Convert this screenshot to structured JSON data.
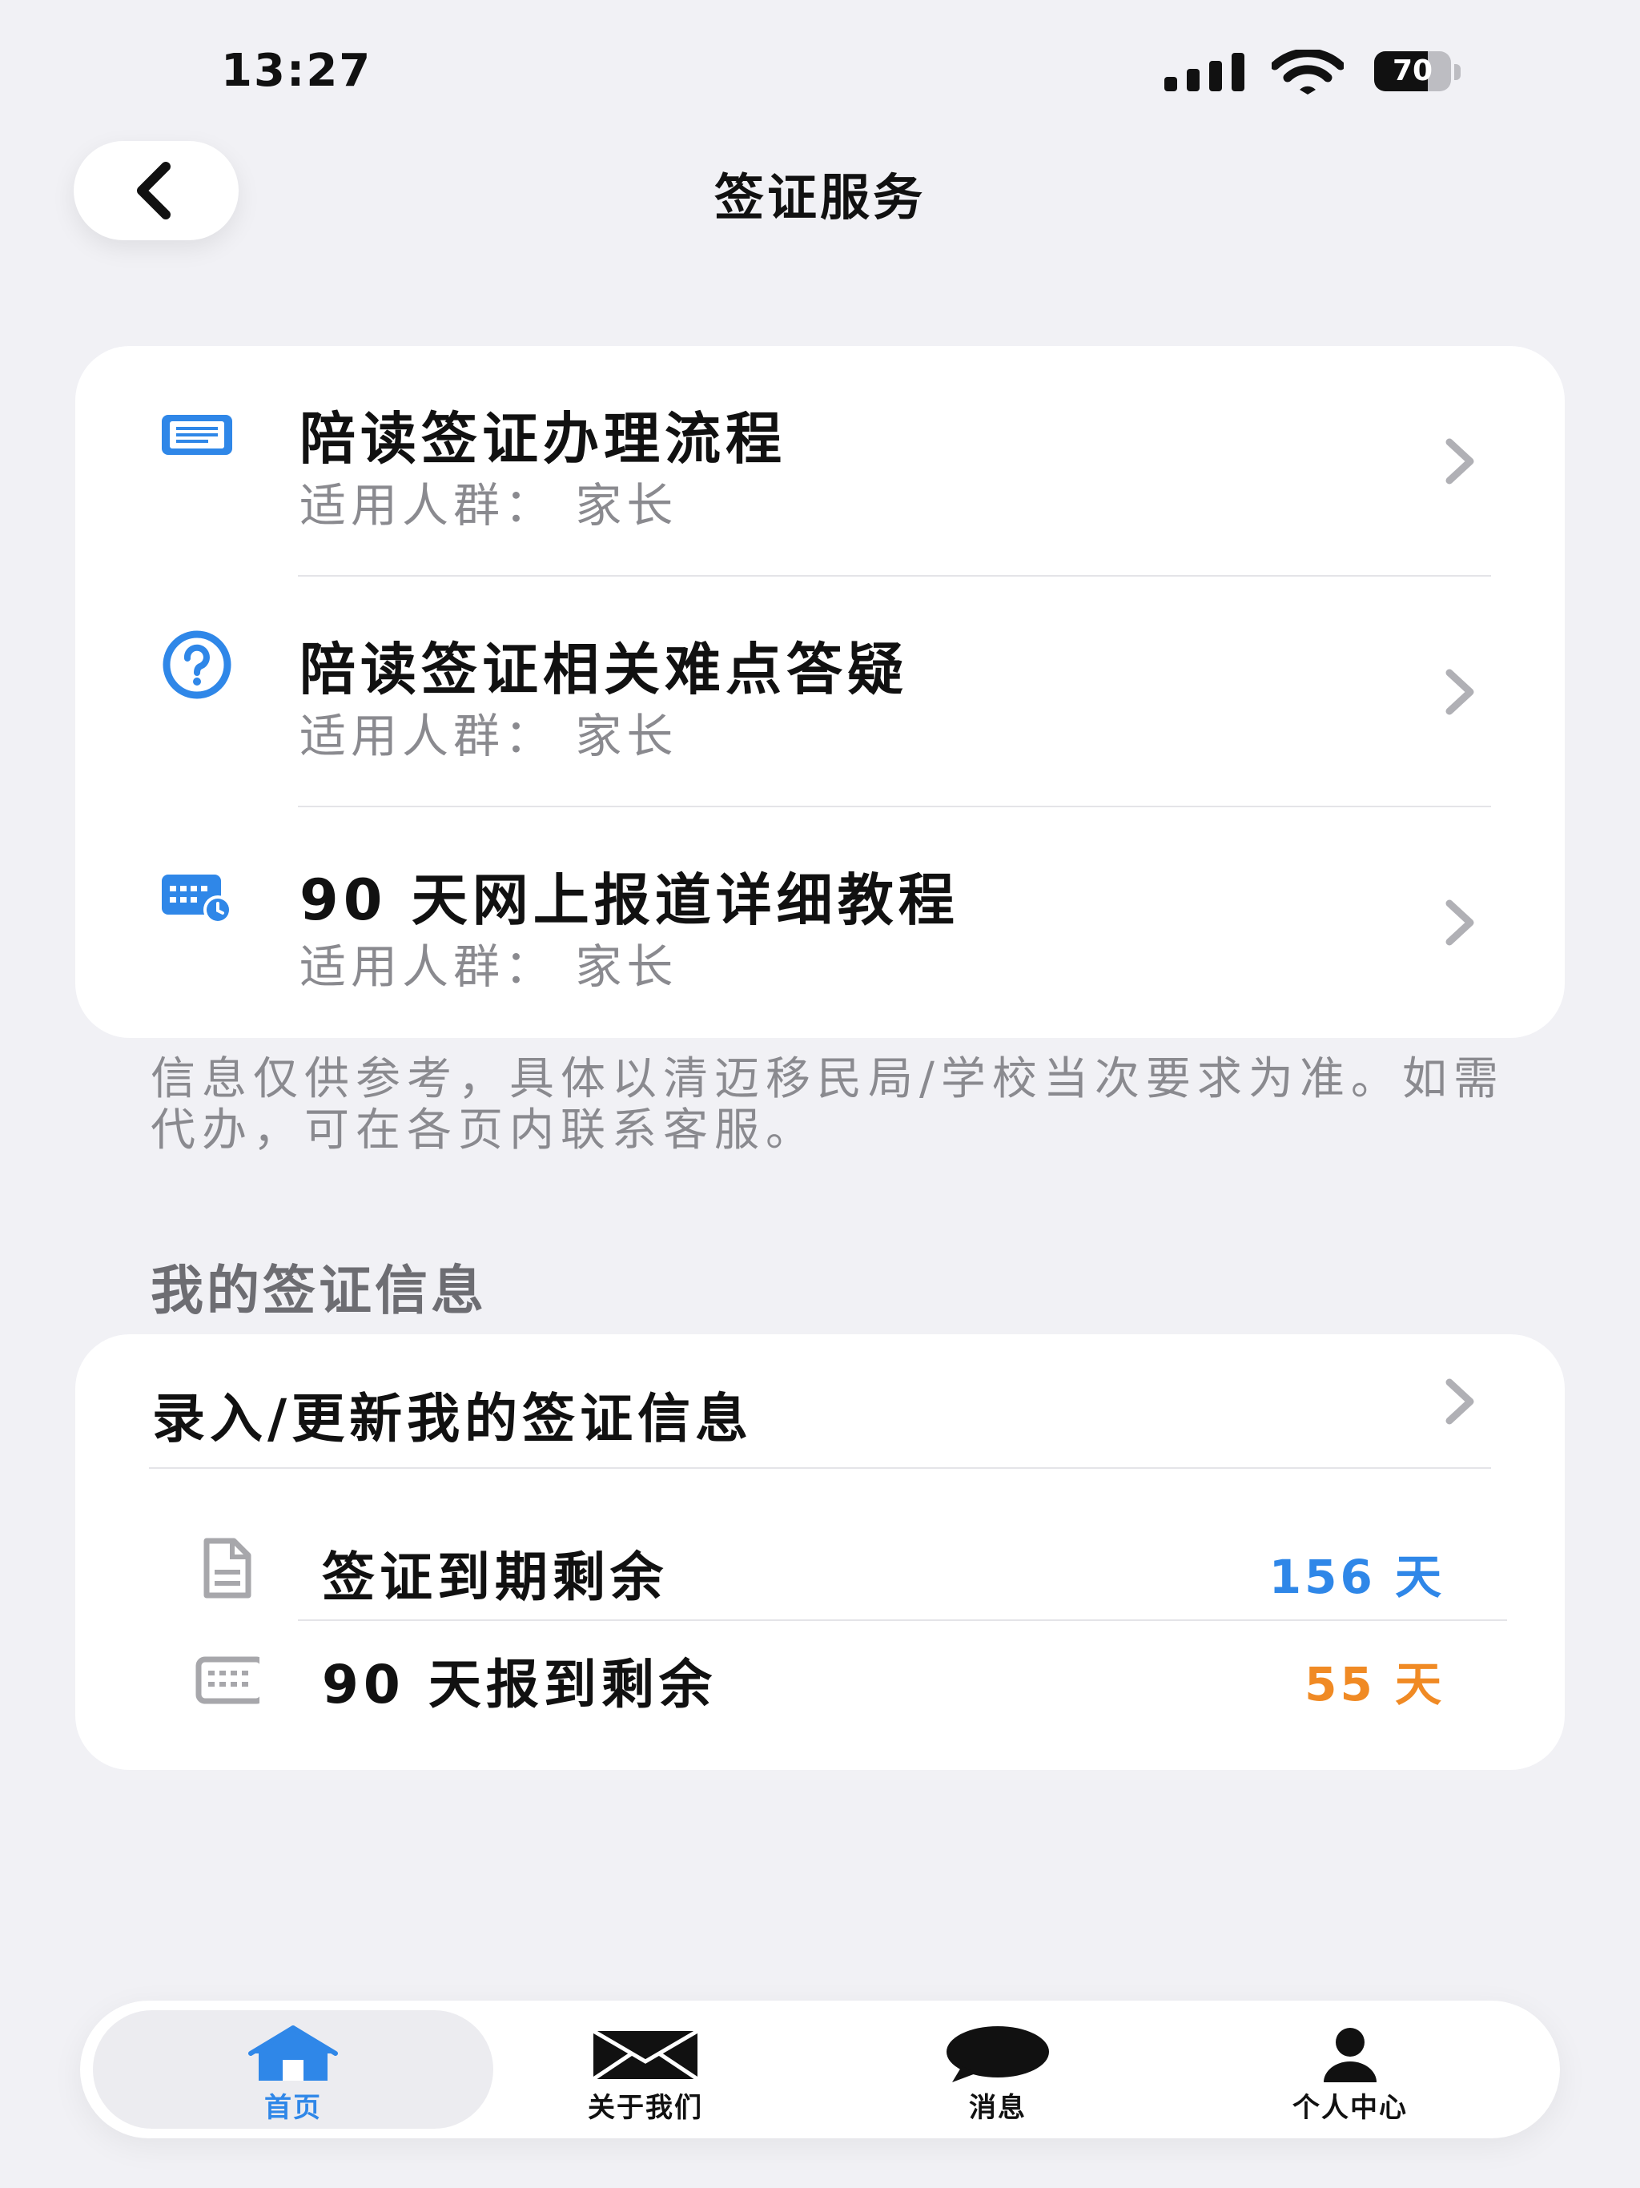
{
  "status_bar": {
    "time": "13:27",
    "battery": "70",
    "battery_level": 0.7
  },
  "nav": {
    "title": "签证服务",
    "back_icon": "chevron-left-icon"
  },
  "services": [
    {
      "title": "陪读签证办理流程",
      "subtitle": "适用人群： 家长",
      "icon": "document-list-icon"
    },
    {
      "title": "陪读签证相关难点答疑",
      "subtitle": "适用人群： 家长",
      "icon": "question-circle-icon"
    },
    {
      "title": "90 天网上报道详细教程",
      "subtitle": "适用人群： 家长",
      "icon": "calendar-clock-icon"
    }
  ],
  "notice": "信息仅供参考，具体以清迈移民局/学校当次要求为准。如需代办，可在各页内联系客服。",
  "my_visa": {
    "section_title": "我的签证信息",
    "update_label": "录入/更新我的签证信息",
    "rows": [
      {
        "label": "签证到期剩余",
        "value": "156 天",
        "color": "#2f87e8",
        "icon": "document-icon"
      },
      {
        "label": "90 天报到剩余",
        "value": "55 天",
        "color": "#f08a24",
        "icon": "calendar-icon"
      }
    ]
  },
  "tabbar": {
    "active_color": "#2f87e8",
    "tabs": [
      {
        "label": "首页",
        "icon": "home-icon",
        "active": true
      },
      {
        "label": "关于我们",
        "icon": "mail-icon",
        "active": false
      },
      {
        "label": "消息",
        "icon": "chat-bubble-icon",
        "active": false
      },
      {
        "label": "个人中心",
        "icon": "person-icon",
        "active": false
      }
    ]
  }
}
